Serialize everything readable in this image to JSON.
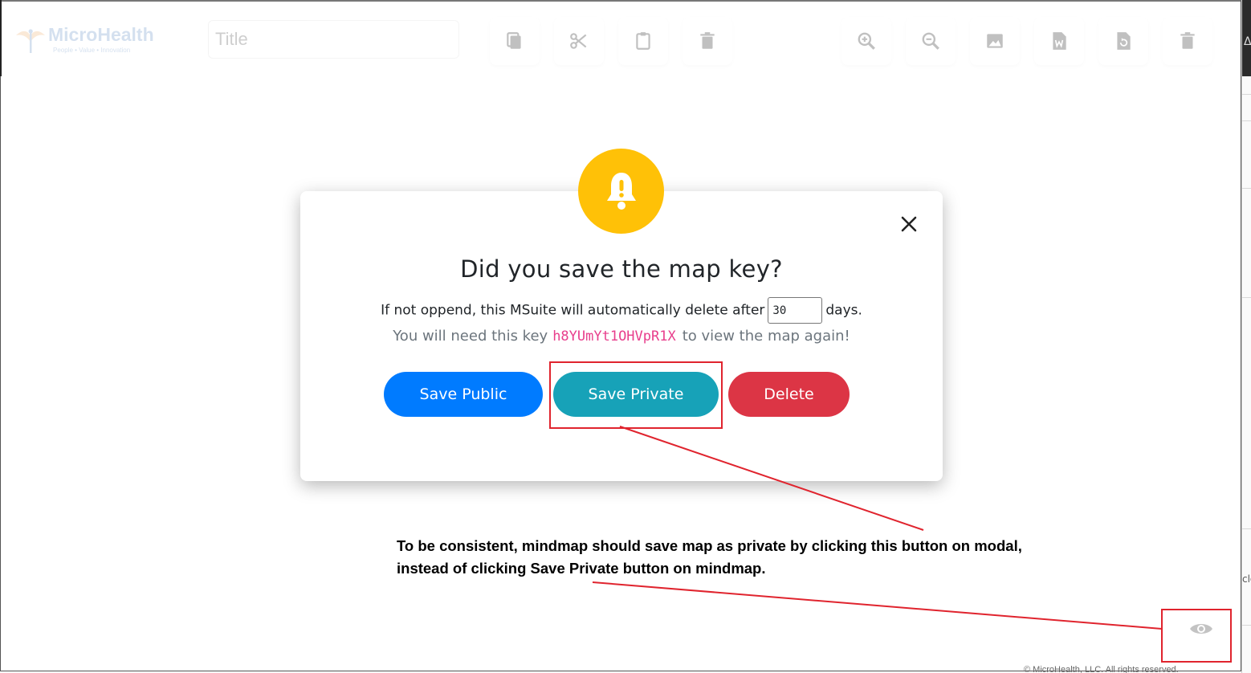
{
  "header": {
    "logo_text": "MicroHealth",
    "logo_tagline": "People • Value • Innovation",
    "title_placeholder": "Title"
  },
  "toolbar": {
    "left_icons": [
      "copy-icon",
      "cut-icon",
      "paste-icon",
      "trash-icon"
    ],
    "right_icons": [
      "zoom-in-icon",
      "zoom-out-icon",
      "image-icon",
      "word-document-icon",
      "reset-icon",
      "delete-all-icon"
    ]
  },
  "modal": {
    "title": "Did you save the map key?",
    "line1_before": "If not oppend, this MSuite will automatically delete after",
    "days_value": "30",
    "line1_after": "days.",
    "line2_before": "You will need this key",
    "map_key": "h8YUmYt1OHVpR1X",
    "line2_after": "to view the map again!",
    "buttons": {
      "save_public": "Save Public",
      "save_private": "Save Private",
      "delete": "Delete"
    },
    "colors": {
      "alert": "#ffc107",
      "save_public": "#007bff",
      "save_private": "#17a2b8",
      "delete": "#dc3545"
    }
  },
  "annotation": {
    "line1": "To be consistent, mindmap should save map as private by clicking this button on modal,",
    "line2": "instead of clicking Save Private button on mindmap.",
    "color": "#e0242e"
  },
  "footer": {
    "partial_text": "© MicroHealth, LLC. All rights reserved."
  },
  "side_peek": {
    "top_char": "Δ",
    "mid_text": "clo"
  }
}
